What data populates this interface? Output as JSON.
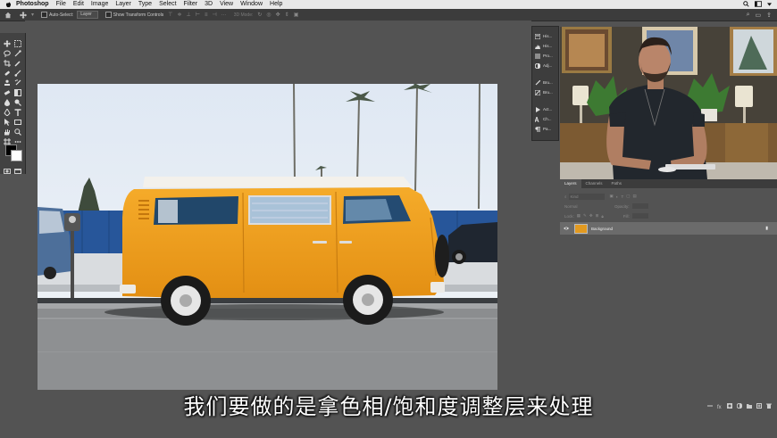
{
  "menubar": {
    "app": "Photoshop",
    "items": [
      "File",
      "Edit",
      "Image",
      "Layer",
      "Type",
      "Select",
      "Filter",
      "3D",
      "View",
      "Window",
      "Help"
    ]
  },
  "options_bar": {
    "auto_select_label": "Auto-Select:",
    "auto_select_value": "Layer",
    "transform_label": "Show Transform Controls",
    "mode_label": "3D Mode:"
  },
  "collapsed_panels": [
    "His...",
    "His...",
    "Pro...",
    "Adj...",
    "Bru...",
    "Bru...",
    "Act...",
    "Ch...",
    "Pa..."
  ],
  "layers_panel": {
    "tabs": [
      "Layers",
      "Channels",
      "Paths"
    ],
    "kind_label": "Kind",
    "blend_label": "Normal",
    "opacity_label": "Opacity:",
    "lock_label": "Lock:",
    "fill_label": "Fill:",
    "layer_name": "Background"
  },
  "subtitle": "我们要做的是拿色相/饱和度调整层来处理",
  "colors": {
    "accent": "#f0a623",
    "panel_bg": "#535353",
    "dark_bg": "#3c3c3c"
  }
}
